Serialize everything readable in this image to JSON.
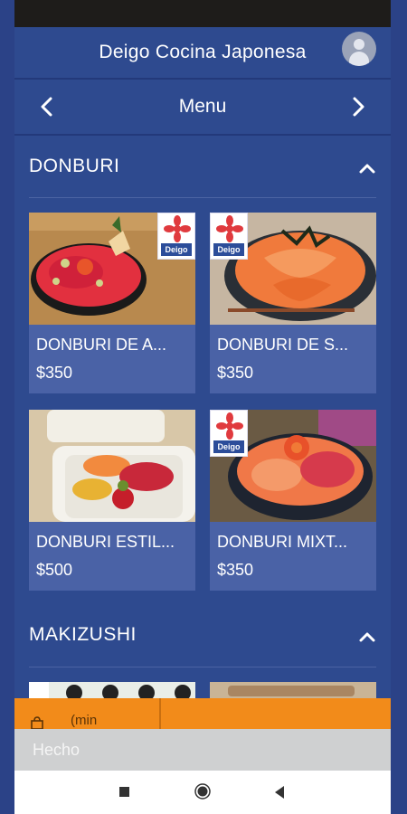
{
  "app": {
    "title": "Deigo Cocina Japonesa",
    "nav_title": "Menu"
  },
  "sections": [
    {
      "title": "DONBURI",
      "items": [
        {
          "name": "DONBURI DE A...",
          "price": "$350"
        },
        {
          "name": "DONBURI DE S...",
          "price": "$350"
        },
        {
          "name": "DONBURI ESTIL...",
          "price": "$500"
        },
        {
          "name": "DONBURI MIXT...",
          "price": "$350"
        }
      ]
    },
    {
      "title": "MAKIZUSHI",
      "items": []
    }
  ],
  "logo_text": "Deigo",
  "order_bar": {
    "min_label": "(min"
  },
  "done_label": "Hecho",
  "colors": {
    "background": "#2e4a8f",
    "card": "#4a62a6",
    "accent_orange": "#f28b1a"
  }
}
